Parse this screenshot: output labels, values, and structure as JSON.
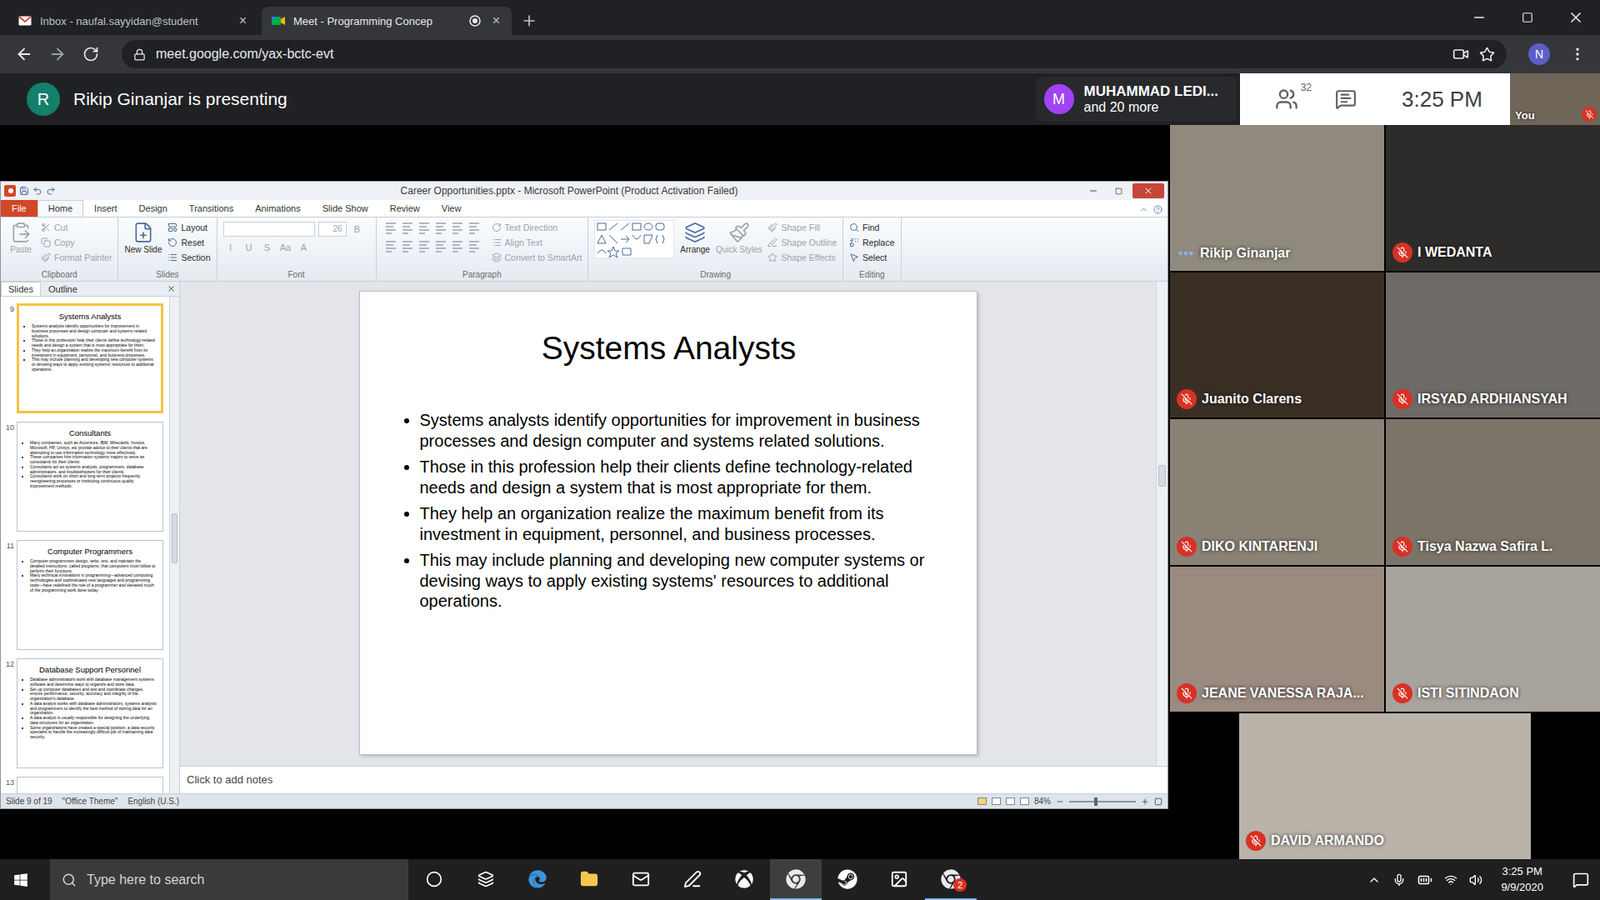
{
  "browser": {
    "tabs": [
      {
        "title": "Inbox - naufal.sayyidan@student",
        "close": "×",
        "selected": false,
        "kind": "gmail"
      },
      {
        "title": "Meet - Programming Concep",
        "close": "×",
        "selected": true,
        "kind": "meet"
      }
    ],
    "url": "meet.google.com/yax-bctc-evt",
    "profile": "N"
  },
  "meet": {
    "presenter": {
      "initial": "R",
      "text": "Rikip Ginanjar is presenting"
    },
    "chip": {
      "initial": "M",
      "name": "MUHAMMAD LEDI...",
      "more": "and 20 more"
    },
    "people_count": "32",
    "time": "3:25 PM",
    "self": {
      "label": "You",
      "muted": true
    },
    "participants": [
      {
        "name": "Rikip Ginanjar",
        "muted": false,
        "speaking": true
      },
      {
        "name": "I WEDANTA",
        "muted": true,
        "speaking": false
      },
      {
        "name": "Juanito Clarens",
        "muted": true,
        "speaking": false
      },
      {
        "name": "IRSYAD ARDHIANSYAH",
        "muted": true,
        "speaking": false
      },
      {
        "name": "DIKO KINTARENJI",
        "muted": true,
        "speaking": false
      },
      {
        "name": "Tisya Nazwa Safira L.",
        "muted": true,
        "speaking": false
      },
      {
        "name": "JEANE VANESSA RAJA...",
        "muted": true,
        "speaking": false
      },
      {
        "name": "ISTI SITINDAON",
        "muted": true,
        "speaking": false
      },
      {
        "name": "DAVID ARMANDO",
        "muted": true,
        "speaking": false
      }
    ]
  },
  "powerpoint": {
    "title": "Career Opportunities.pptx - Microsoft PowerPoint (Product Activation Failed)",
    "ribbon_tabs": [
      {
        "label": "File",
        "selected": false,
        "kind": "file"
      },
      {
        "label": "Home",
        "selected": true,
        "kind": "tab"
      },
      {
        "label": "Insert",
        "selected": false,
        "kind": "tab"
      },
      {
        "label": "Design",
        "selected": false,
        "kind": "tab"
      },
      {
        "label": "Transitions",
        "selected": false,
        "kind": "tab"
      },
      {
        "label": "Animations",
        "selected": false,
        "kind": "tab"
      },
      {
        "label": "Slide Show",
        "selected": false,
        "kind": "tab"
      },
      {
        "label": "Review",
        "selected": false,
        "kind": "tab"
      },
      {
        "label": "View",
        "selected": false,
        "kind": "tab"
      }
    ],
    "ribbon_groups": [
      {
        "label": "Clipboard",
        "items": [
          {
            "text": "Paste",
            "kind": "large",
            "disabled": true
          },
          {
            "text": "Cut",
            "kind": "small",
            "disabled": true
          },
          {
            "text": "Copy",
            "kind": "small",
            "disabled": true
          },
          {
            "text": "Format Painter",
            "kind": "small",
            "disabled": true
          }
        ]
      },
      {
        "label": "Slides",
        "items": [
          {
            "text": "New Slide",
            "kind": "large",
            "disabled": false
          },
          {
            "text": "Layout",
            "kind": "small",
            "disabled": false
          },
          {
            "text": "Reset",
            "kind": "small",
            "disabled": false
          },
          {
            "text": "Section",
            "kind": "small",
            "disabled": false
          }
        ]
      },
      {
        "label": "Font",
        "items": [
          {
            "text": "26",
            "kind": "field",
            "disabled": true
          },
          {
            "text": "B",
            "kind": "glyph",
            "disabled": true
          },
          {
            "text": "I",
            "kind": "glyph",
            "disabled": true
          },
          {
            "text": "U",
            "kind": "glyph",
            "disabled": true
          },
          {
            "text": "S",
            "kind": "glyph",
            "disabled": true
          },
          {
            "text": "Aa",
            "kind": "glyph",
            "disabled": true
          },
          {
            "text": "A",
            "kind": "glyph",
            "disabled": true
          }
        ]
      },
      {
        "label": "Paragraph",
        "items": [
          {
            "text": "",
            "kind": "tools",
            "disabled": true
          },
          {
            "text": "Text Direction",
            "kind": "small",
            "disabled": true
          },
          {
            "text": "Align Text",
            "kind": "small",
            "disabled": true
          },
          {
            "text": "Convert to SmartArt",
            "kind": "small",
            "disabled": true
          }
        ]
      },
      {
        "label": "Drawing",
        "items": [
          {
            "text": "",
            "kind": "shapes",
            "disabled": false
          },
          {
            "text": "Arrange",
            "kind": "large",
            "disabled": false
          },
          {
            "text": "Quick Styles",
            "kind": "large",
            "disabled": true
          },
          {
            "text": "Shape Fill",
            "kind": "small",
            "disabled": true
          },
          {
            "text": "Shape Outline",
            "kind": "small",
            "disabled": true
          },
          {
            "text": "Shape Effects",
            "kind": "small",
            "disabled": true
          }
        ]
      },
      {
        "label": "Editing",
        "items": [
          {
            "text": "Find",
            "kind": "small",
            "disabled": false
          },
          {
            "text": "Replace",
            "kind": "small",
            "disabled": false
          },
          {
            "text": "Select",
            "kind": "small",
            "disabled": false
          }
        ]
      }
    ],
    "panel_tabs": [
      {
        "label": "Slides",
        "selected": true
      },
      {
        "label": "Outline",
        "selected": false
      }
    ],
    "thumbnails": [
      {
        "number": "9",
        "title": "Systems Analysts",
        "selected": true,
        "bullets": [
          "Systems analysts identify opportunities for improvement in business processes and design computer and systems related solutions.",
          "Those in this profession help their clients define technology-related needs and design a system that is most appropriate for them.",
          "They help an organization realize the maximum benefit from its investment in equipment, personnel, and business processes.",
          "This may include planning and developing new computer systems or devising ways to apply existing systems' resources to additional operations."
        ]
      },
      {
        "number": "10",
        "title": "Consultants",
        "selected": false,
        "bullets": [
          "Many companies, such as Accenture, IBM, Wirecards, Invoice, Microsoft, HP, Unisys, etc provide advice to their clients that are attempting to use information technology more effectively.",
          "These companies hire information systems majors to serve as consultants for their clients.",
          "Consultants act as systems analysts, programmers, database administrators, and troubleshooters for their clients.",
          "Consultants work on short and long-term projects frequently reengineering processes or instituting continuous quality improvement methods."
        ]
      },
      {
        "number": "11",
        "title": "Computer Programmers",
        "selected": false,
        "bullets": [
          "Computer programmers design, write, test, and maintain the detailed instructions, called programs, that computers must follow to perform their functions.",
          "Many technical innovations in programming—advanced computing technologies and sophisticated new languages and programming tools—have redefined the role of a programmer and elevated much of the programming work done today."
        ]
      },
      {
        "number": "12",
        "title": "Database Support Personnel",
        "selected": false,
        "bullets": [
          "Database administrators work with database management systems software and determine ways to organize and store data.",
          "Set up computer databases and test and coordinate changes, ensure performance, security, accuracy and integrity of the organization's database.",
          "A data analyst works with database administrators, systems analysts and programmers to identify the best method of storing data for an organization.",
          "A data analyst is usually responsible for designing the underlying data structures for an organization.",
          "Some organizations have created a special position, a data security specialist to handle the increasingly difficult job of maintaining data security."
        ]
      },
      {
        "number": "13",
        "title": "",
        "selected": false,
        "bullets": []
      }
    ],
    "slide": {
      "title": "Systems Analysts",
      "bullets": [
        "Systems analysts identify opportunities for improvement in business processes and design computer and systems related solutions.",
        "Those in this profession help their clients define technology-related needs and design a system that is most appropriate for them.",
        "They help an organization realize the maximum benefit from its investment in equipment, personnel, and business processes.",
        "This may include planning and developing new computer systems or devising ways to apply existing systems' resources to additional operations."
      ]
    },
    "notes_placeholder": "Click to add notes",
    "status": {
      "slide": "Slide 9 of 19",
      "theme": "\"Office Theme\"",
      "language": "English (U.S.)",
      "zoom": "84%",
      "zoom_level": 0.4
    }
  },
  "taskbar": {
    "search_placeholder": "Type here to search",
    "time": "3:25 PM",
    "date": "9/9/2020",
    "apps": [
      {
        "kind": "cortana",
        "open": false,
        "selected": false
      },
      {
        "kind": "taskview",
        "open": false,
        "selected": false
      },
      {
        "kind": "edge",
        "open": false,
        "selected": false
      },
      {
        "kind": "explorer",
        "open": false,
        "selected": false
      },
      {
        "kind": "mail",
        "open": false,
        "selected": false
      },
      {
        "kind": "pen",
        "open": false,
        "selected": false
      },
      {
        "kind": "xbox",
        "open": false,
        "selected": false
      },
      {
        "kind": "chrome",
        "open": true,
        "selected": true
      },
      {
        "kind": "steam",
        "open": false,
        "selected": false
      },
      {
        "kind": "photos",
        "open": false,
        "selected": false
      },
      {
        "kind": "chrome",
        "open": true,
        "selected": false,
        "badge": "2"
      }
    ]
  }
}
